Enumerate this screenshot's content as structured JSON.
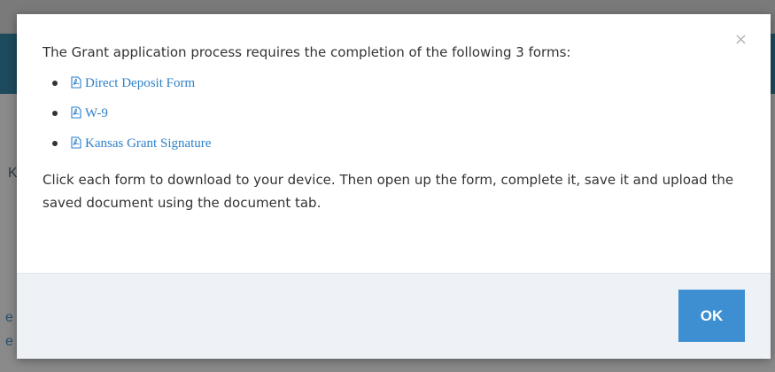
{
  "background": {
    "fragment_k": "K",
    "fragment_e1": "e",
    "fragment_e2": "e"
  },
  "modal": {
    "close_label": "×",
    "intro": "The Grant application process requires the completion of the following 3 forms:",
    "forms": [
      {
        "icon": "pdf-icon",
        "label": "Direct Deposit Form"
      },
      {
        "icon": "pdf-icon",
        "label": "W-9"
      },
      {
        "icon": "pdf-icon",
        "label": "Kansas Grant Signature"
      }
    ],
    "instructions": "Click each form to download to your device. Then open up the form, complete it, save it and upload the saved document using the document tab.",
    "ok_label": "OK"
  },
  "colors": {
    "link": "#2f80c8",
    "primary_button": "#3d8fd1",
    "footer_bg": "#eef2f7",
    "overlay_header": "#1d4a5c"
  }
}
